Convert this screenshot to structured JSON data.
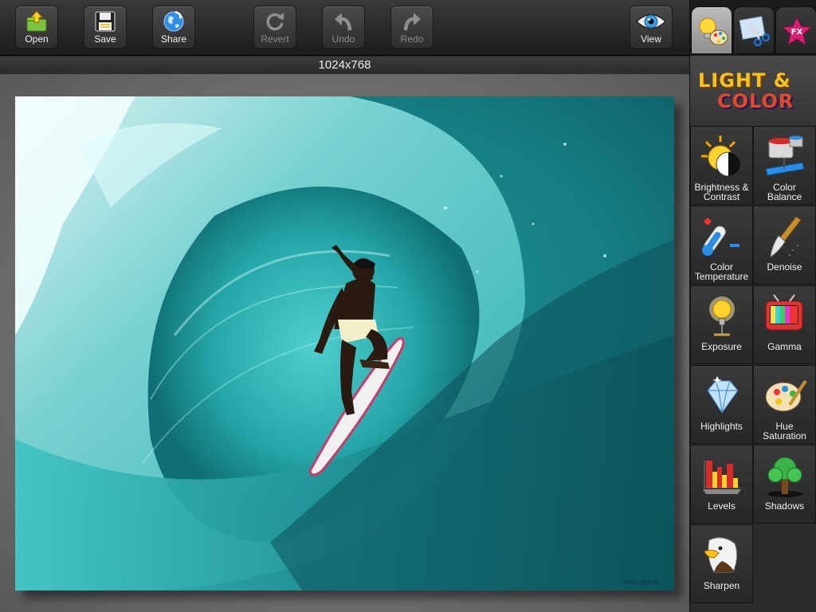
{
  "toolbar": {
    "open": {
      "label": "Open",
      "icon": "open-folder-icon"
    },
    "save": {
      "label": "Save",
      "icon": "floppy-disk-icon"
    },
    "share": {
      "label": "Share",
      "icon": "globe-icon"
    },
    "revert": {
      "label": "Revert",
      "icon": "refresh-icon",
      "disabled": true
    },
    "undo": {
      "label": "Undo",
      "icon": "undo-arrow-icon",
      "disabled": true
    },
    "redo": {
      "label": "Redo",
      "icon": "redo-arrow-icon",
      "disabled": true
    },
    "view": {
      "label": "View",
      "icon": "eye-icon"
    }
  },
  "canvas": {
    "size_label": "1024x768",
    "watermark": "www.xpor.tk"
  },
  "panel": {
    "tabs": [
      {
        "name": "light-and-color",
        "icon": "bulb-palette-icon",
        "active": true
      },
      {
        "name": "crop",
        "icon": "scissors-icon",
        "active": false
      },
      {
        "name": "effects",
        "icon": "fx-star-icon",
        "active": false,
        "text": "FX"
      }
    ],
    "header": {
      "line1": "LIGHT &",
      "line2": "COLOR"
    },
    "tools": [
      {
        "label1": "Brightness &",
        "label2": "Contrast",
        "icon": "sun-contrast-icon"
      },
      {
        "label1": "Color",
        "label2": "Balance",
        "icon": "paint-bucket-icon"
      },
      {
        "label1": "Color",
        "label2": "Temperature",
        "icon": "thermometer-icon"
      },
      {
        "label1": "Denoise",
        "label2": "",
        "icon": "brush-icon"
      },
      {
        "label1": "Exposure",
        "label2": "",
        "icon": "light-bulb-icon"
      },
      {
        "label1": "Gamma",
        "label2": "",
        "icon": "tv-icon"
      },
      {
        "label1": "Highlights",
        "label2": "",
        "icon": "diamond-icon"
      },
      {
        "label1": "Hue",
        "label2": "Saturation",
        "icon": "palette-icon"
      },
      {
        "label1": "Levels",
        "label2": "",
        "icon": "levels-chart-icon"
      },
      {
        "label1": "Shadows",
        "label2": "",
        "icon": "tree-icon"
      },
      {
        "label1": "Sharpen",
        "label2": "",
        "icon": "eagle-icon"
      }
    ]
  },
  "colors": {
    "accent_yellow": "#f7c21b",
    "accent_red": "#e04a2a",
    "accent_blue": "#2f8fe6",
    "photo_teal": "#1fa3a3"
  }
}
